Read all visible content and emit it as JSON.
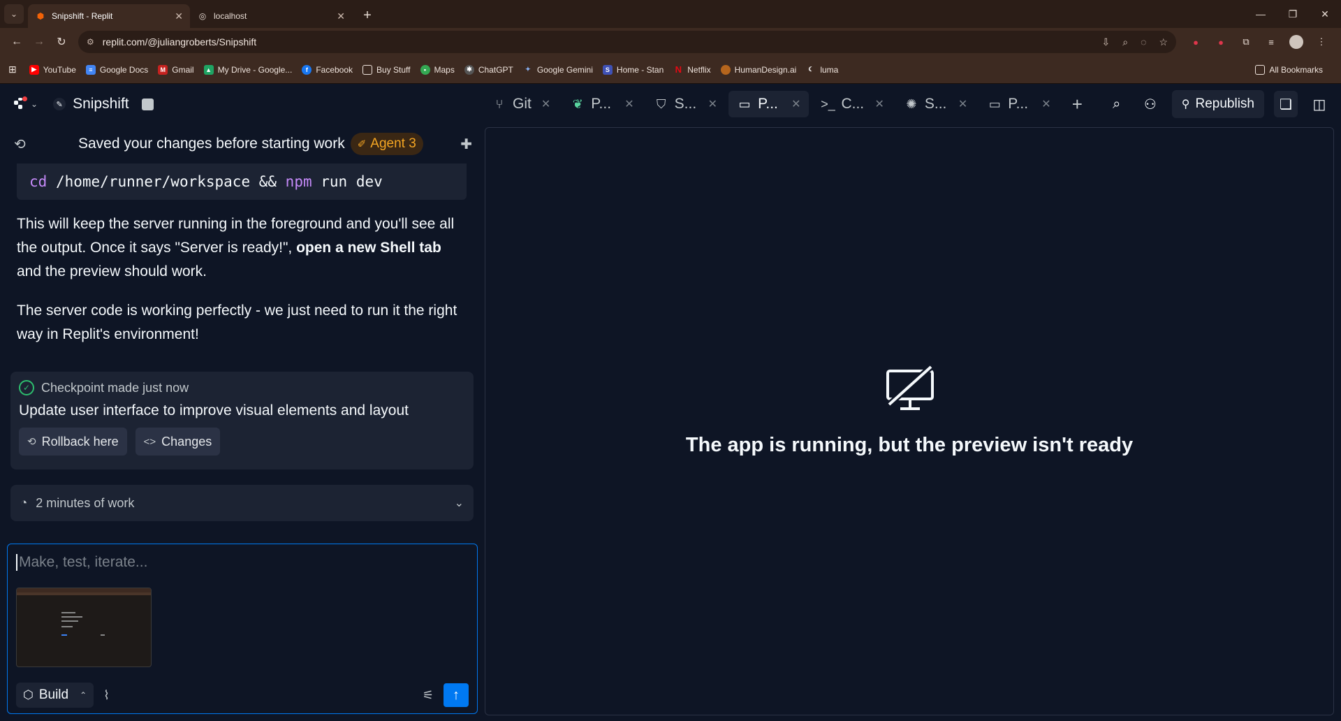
{
  "browser": {
    "tabs": [
      {
        "title": "Snipshift - Replit",
        "active": true
      },
      {
        "title": "localhost",
        "active": false
      }
    ],
    "url": "replit.com/@juliangroberts/Snipshift",
    "bookmarks": [
      "YouTube",
      "Google Docs",
      "Gmail",
      "My Drive - Google...",
      "Facebook",
      "Buy Stuff",
      "Maps",
      "ChatGPT",
      "Google Gemini",
      "Home - Stan",
      "Netflix",
      "HumanDesign.ai",
      "luma"
    ],
    "all_bookmarks": "All Bookmarks"
  },
  "replit": {
    "project_name": "Snipshift",
    "workspace_tabs": [
      {
        "label": "Git",
        "icon": "git-icon",
        "active": false
      },
      {
        "label": "P...",
        "icon": "packages-icon",
        "active": false
      },
      {
        "label": "S...",
        "icon": "shield-icon",
        "active": false
      },
      {
        "label": "P...",
        "icon": "monitor-icon",
        "active": true
      },
      {
        "label": "C...",
        "icon": "console-icon",
        "active": false
      },
      {
        "label": "S...",
        "icon": "shell-icon",
        "active": false
      },
      {
        "label": "P...",
        "icon": "monitor-icon",
        "active": false
      }
    ],
    "republish_label": "Republish"
  },
  "agent": {
    "status_message": "Saved your changes before starting work",
    "badge": "Agent 3",
    "code_cmd1": "cd",
    "code_path": " /home/runner/workspace && ",
    "code_cmd2": "npm",
    "code_rest": " run dev",
    "para1_a": "This will keep the server running in the foreground and you'll see all the output. Once it says \"Server is ready!\", ",
    "para1_bold": "open a new Shell tab",
    "para1_b": " and the preview should work.",
    "para2": "The server code is working perfectly - we just need to run it the right way in Replit's environment!",
    "checkpoint": {
      "label": "Checkpoint made just now",
      "title": "Update user interface to improve visual elements and layout",
      "rollback": "Rollback here",
      "changes": "Changes"
    },
    "work_time": "2 minutes of work",
    "composer_placeholder": "Make, test, iterate...",
    "build_label": "Build"
  },
  "preview": {
    "message": "The app is running, but the preview isn't ready"
  }
}
